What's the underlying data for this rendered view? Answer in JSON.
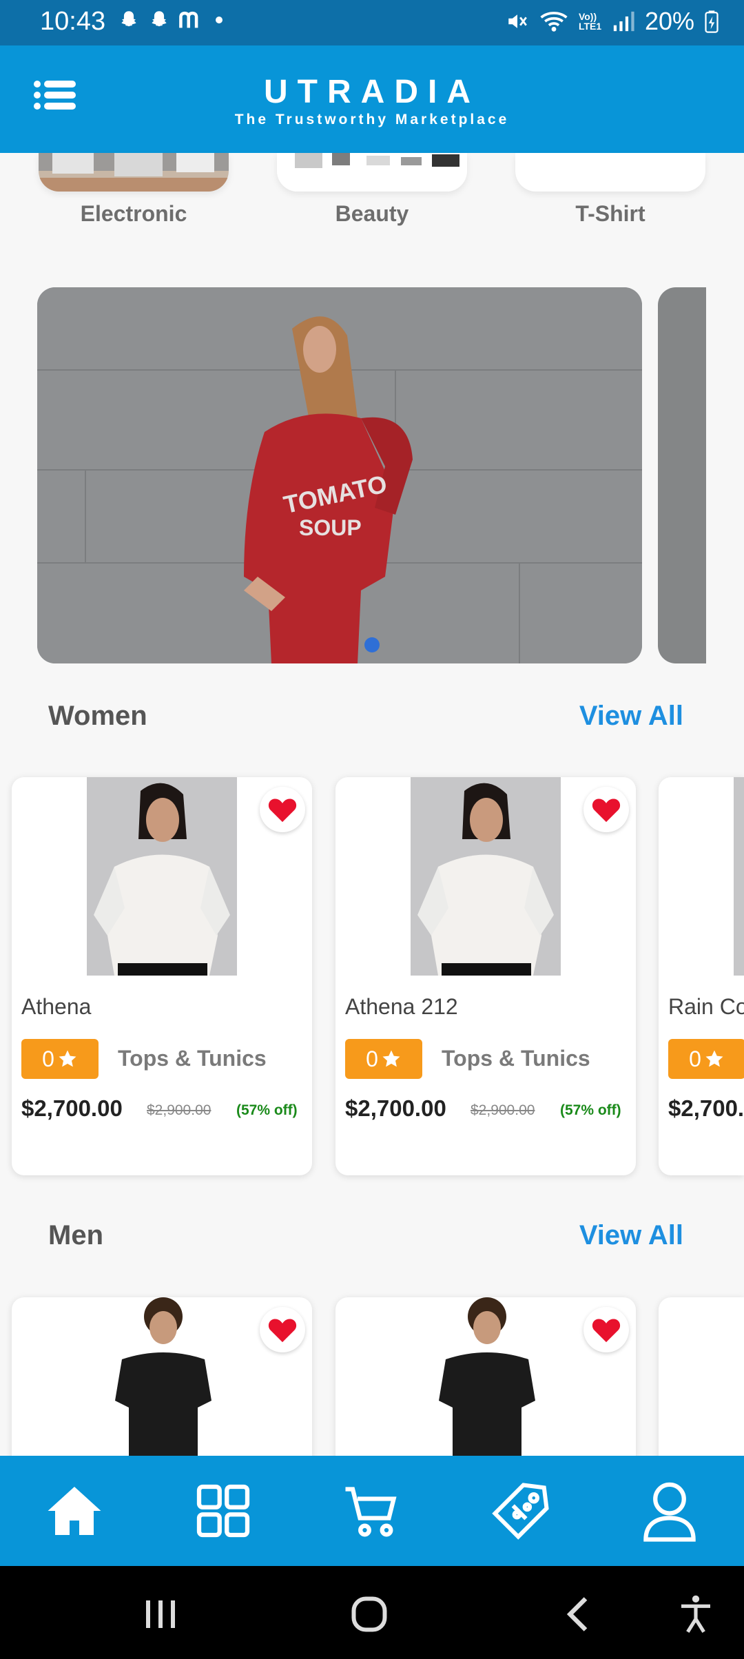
{
  "status_bar": {
    "time": "10:43",
    "left_icons": [
      "snapchat-icon",
      "snapchat-icon",
      "messenger-icon",
      "dot-icon"
    ],
    "network_label": "Vo)) LTE1",
    "battery": "20%"
  },
  "app_bar": {
    "title": "UTRADIA",
    "subtitle": "The Trustworthy Marketplace"
  },
  "categories": [
    {
      "label": "Electronic"
    },
    {
      "label": "Beauty"
    },
    {
      "label": "T-Shirt"
    }
  ],
  "banner": {
    "shirt_text_line1": "TOMATO",
    "shirt_text_line2": "SOUP",
    "active_dot": 1
  },
  "sections": {
    "women": {
      "title": "Women",
      "view_all": "View All"
    },
    "men": {
      "title": "Men",
      "view_all": "View All"
    }
  },
  "women_products": [
    {
      "name": "Athena",
      "rating": "0",
      "category": "Tops & Tunics",
      "price": "$2,700.00",
      "old_price": "$2,900.00",
      "discount": "(57% off)"
    },
    {
      "name": "Athena 212",
      "rating": "0",
      "category": "Tops & Tunics",
      "price": "$2,700.00",
      "old_price": "$2,900.00",
      "discount": "(57% off)"
    },
    {
      "name": "Rain Co",
      "rating": "0",
      "price": "$2,700."
    }
  ],
  "bottom_nav": [
    "home-icon",
    "categories-icon",
    "cart-icon",
    "offers-icon",
    "profile-icon"
  ],
  "colors": {
    "primary": "#0895d8",
    "status_bar": "#0d6fa8",
    "rating_badge": "#f79a1b",
    "discount": "#1a8a1a",
    "link": "#1e8fe0",
    "favorite": "#e8112d"
  }
}
